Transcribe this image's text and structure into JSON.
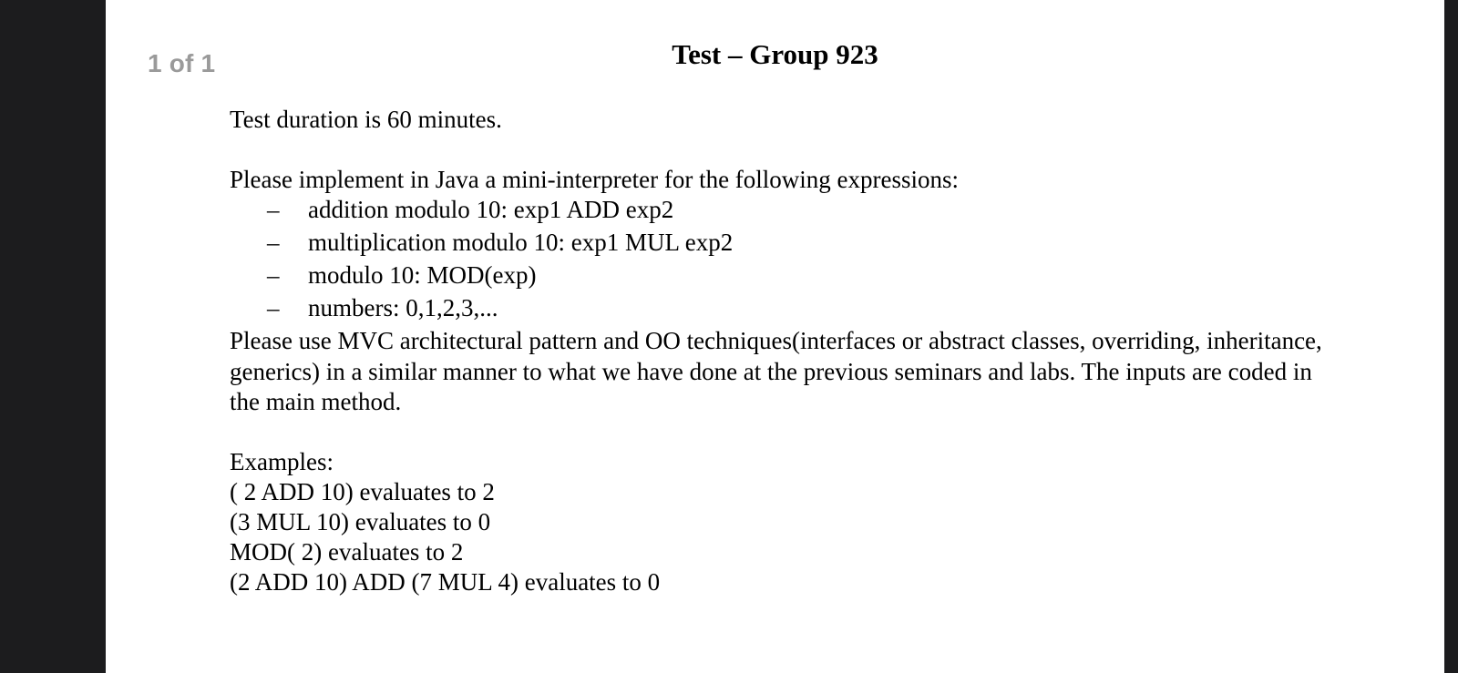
{
  "viewer": {
    "page_indicator": "1 of 1"
  },
  "document": {
    "title": "Test – Group 923",
    "duration": "Test duration is 60 minutes.",
    "intro": "Please implement in Java a mini-interpreter for the following expressions:",
    "bullet_marker": "–",
    "bullets": [
      "addition modulo 10: exp1 ADD exp2",
      "multiplication modulo 10: exp1 MUL exp2",
      "modulo 10: MOD(exp)",
      "numbers: 0,1,2,3,..."
    ],
    "instructions": "Please use MVC architectural pattern and  OO techniques(interfaces or abstract classes, overriding, inheritance, generics) in a similar manner to what we have done at the previous seminars and labs. The inputs are coded in the main method.",
    "examples_heading": "Examples:",
    "examples": [
      "( 2 ADD 10) evaluates to 2",
      "(3 MUL 10) evaluates to 0",
      "MOD( 2) evaluates to 2",
      "(2 ADD 10) ADD (7 MUL 4) evaluates to 0"
    ]
  }
}
